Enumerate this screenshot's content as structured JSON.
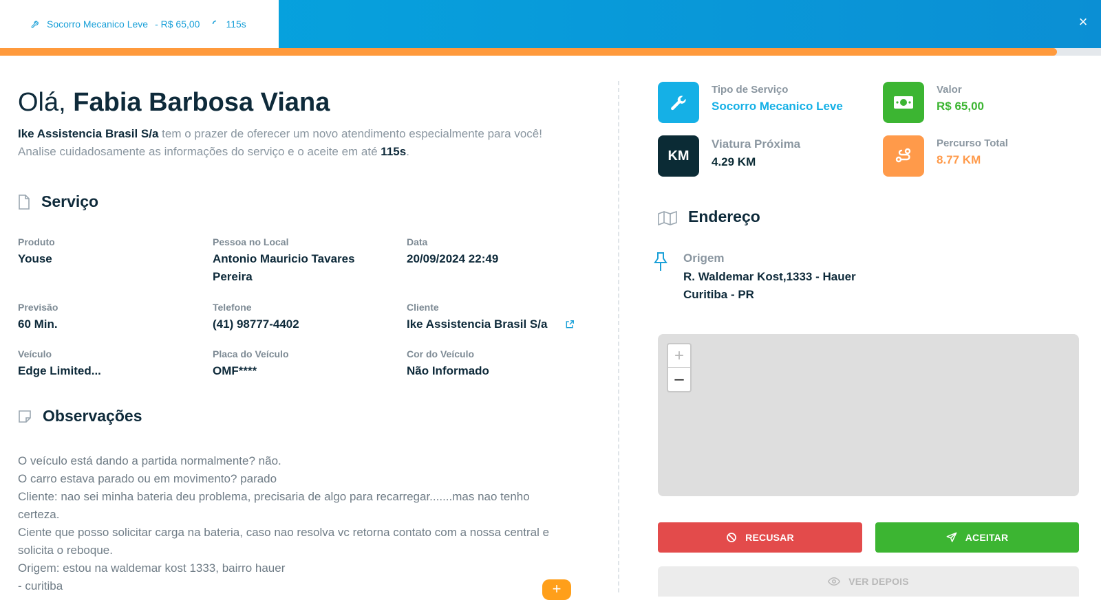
{
  "tab": {
    "service": "Socorro Mecanico Leve",
    "price": "- R$ 65,00",
    "timer": "115s"
  },
  "progress_percent": 96,
  "header": {
    "greeting": "Olá,",
    "name": "Fabia Barbosa Viana",
    "company": "Ike Assistencia Brasil S/a",
    "intro_rest": " tem o prazer de oferecer um novo atendimento especialmente para você!",
    "intro_line2": "Analise cuidadosamente as informações do serviço e o aceite em até ",
    "time_limit": "115s",
    "period": "."
  },
  "servico": {
    "title": "Serviço",
    "fields": {
      "produto": {
        "label": "Produto",
        "value": "Youse"
      },
      "pessoa": {
        "label": "Pessoa no Local",
        "value": "Antonio Mauricio Tavares",
        "value2": "Pereira"
      },
      "data": {
        "label": "Data",
        "value": "20/09/2024 22:49"
      },
      "previsao": {
        "label": "Previsão",
        "value": "60 Min."
      },
      "telefone": {
        "label": "Telefone",
        "value": "(41) 98777-4402"
      },
      "cliente": {
        "label": "Cliente",
        "value": "Ike Assistencia Brasil S/a"
      },
      "veiculo": {
        "label": "Veículo",
        "value": "Edge Limited..."
      },
      "placa": {
        "label": "Placa do Veículo",
        "value": "OMF****"
      },
      "cor": {
        "label": "Cor do Veículo",
        "value": "Não Informado"
      }
    }
  },
  "observacoes": {
    "title": "Observações",
    "lines": [
      "O veículo está dando a partida normalmente? não.",
      "O carro estava parado ou em movimento? parado",
      "Cliente: nao sei minha bateria deu problema, precisaria de algo para recarregar.......mas nao tenho",
      "certeza.",
      "Ciente que posso solicitar carga na bateria, caso nao resolva vc retorna contato com a nossa central e",
      "solicita o reboque.",
      "Origem: estou na waldemar kost 1333, bairro hauer",
      "- curitiba"
    ]
  },
  "cards": {
    "tipo": {
      "label": "Tipo de Serviço",
      "value": "Socorro Mecanico Leve",
      "color": "#15b0e6"
    },
    "valor": {
      "label": "Valor",
      "value": "R$ 65,00",
      "color": "#3cb532"
    },
    "viatura": {
      "label": "Viatura Próxima",
      "value": "4.29 KM",
      "icon_text": "KM",
      "color": "#0b2b35"
    },
    "percurso": {
      "label": "Percurso Total",
      "value": "8.77 KM",
      "color": "#ff9a4a"
    }
  },
  "endereco": {
    "title": "Endereço",
    "origem_label": "Origem",
    "line1": "R. Waldemar Kost,1333 - Hauer",
    "line2": "Curitiba - PR"
  },
  "map": {
    "zoom_in": "+",
    "zoom_out": "–"
  },
  "buttons": {
    "recusar": "RECUSAR",
    "aceitar": "ACEITAR",
    "ver_depois": "VER DEPOIS"
  },
  "fab_label": "+",
  "close_label": "×"
}
